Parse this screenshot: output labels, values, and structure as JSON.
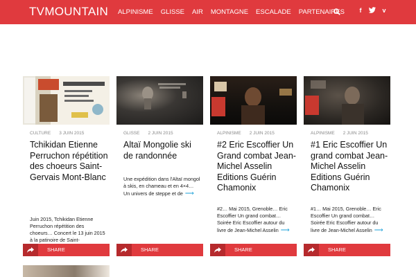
{
  "header": {
    "logo": "TVMOUNTAIN",
    "nav": [
      "ALPINISME",
      "GLISSE",
      "AIR",
      "MONTAGNE",
      "ESCALADE",
      "PARTENAIRES"
    ],
    "social": [
      "f",
      "t",
      "v"
    ],
    "accent_color": "#e03a3e"
  },
  "cards": [
    {
      "category": "CULTURE",
      "date": "3 JUIN 2015",
      "title": "Tchikidan Etienne Perruchon répétition des choeurs Saint-Gervais Mont-Blanc",
      "excerpt": "Juin 2015, Tchikidan Etienne Perruchon répétition des choeurs… Concert le 13 juin 2015 à la patinoire de Saint-",
      "more": "",
      "share": "SHARE"
    },
    {
      "category": "GLISSE",
      "date": "2 JUIN 2015",
      "title": "Altaï Mongolie ski de randonnée",
      "excerpt": "Une expédition dans l'Altaï mongol à skis, en chameau et en 4×4… Un univers de steppe et de",
      "more": "⟶",
      "share": "SHARE"
    },
    {
      "category": "ALPINISME",
      "date": "2 JUIN 2015",
      "title": "#2 Eric Escoffier Un Grand combat Jean-Michel Asselin Editions Guérin Chamonix",
      "excerpt": "#2… Mai 2015, Grenoble… Eric Escoffier Un grand combat… Soirée Eric Escoffier autour du livre de Jean-Michel Asselin",
      "more": "⟶",
      "share": "SHARE"
    },
    {
      "category": "ALPINISME",
      "date": "2 JUIN 2015",
      "title": "#1 Eric Escoffier Un grand combat Jean-Michel Asselin Editions Guérin Chamonix",
      "excerpt": "#1… Mai 2015, Grenoble… Eric Escoffier Un grand combat… Soirée Eric Escoffier autour du livre de Jean-Michel Asselin",
      "more": "⟶",
      "share": "SHARE"
    }
  ]
}
